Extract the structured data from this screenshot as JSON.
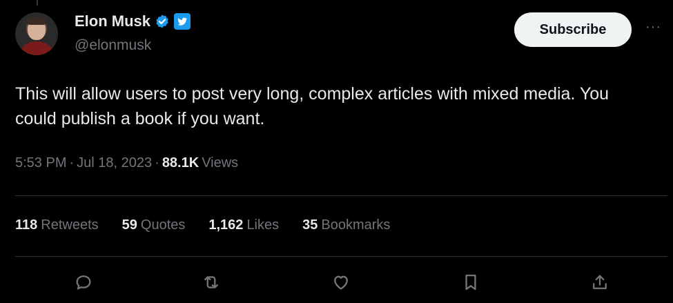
{
  "author": {
    "name": "Elon Musk",
    "handle": "@elonmusk"
  },
  "subscribe_label": "Subscribe",
  "more_label": "···",
  "tweet": {
    "text": "This will allow users to post very long, complex articles with mixed media. You could publish a book if you want.",
    "time": "5:53 PM",
    "date": "Jul 18, 2023",
    "separator": "·",
    "views_count": "88.1K",
    "views_label": "Views"
  },
  "stats": [
    {
      "count": "118",
      "label": "Retweets"
    },
    {
      "count": "59",
      "label": "Quotes"
    },
    {
      "count": "1,162",
      "label": "Likes"
    },
    {
      "count": "35",
      "label": "Bookmarks"
    }
  ],
  "actions": [
    "reply-icon",
    "retweet-icon",
    "like-icon",
    "bookmark-icon",
    "share-icon"
  ],
  "colors": {
    "background": "#000000",
    "text": "#e7e9ea",
    "muted": "#71767b",
    "accent": "#1d9bf0",
    "divider": "#2f3336"
  }
}
